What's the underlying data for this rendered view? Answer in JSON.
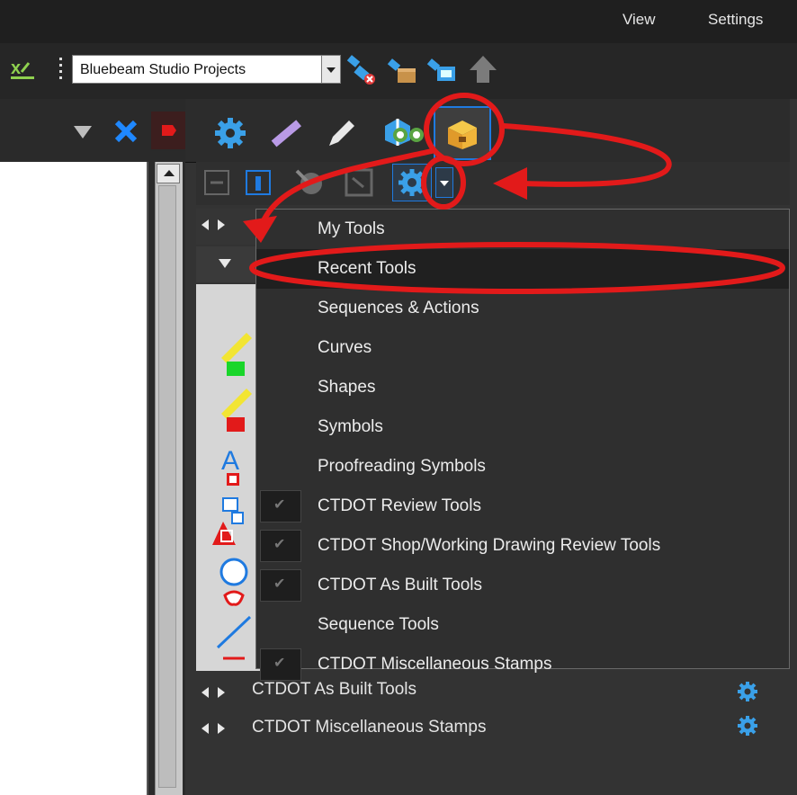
{
  "menubar": {
    "items": [
      "View",
      "Settings"
    ]
  },
  "toolbar": {
    "project_select_value": "Bluebeam Studio Projects"
  },
  "dropdown": {
    "items": [
      {
        "label": "My Tools",
        "checked": false
      },
      {
        "label": "Recent Tools",
        "checked": false
      },
      {
        "label": "Sequences & Actions",
        "checked": false
      },
      {
        "label": "Curves",
        "checked": false
      },
      {
        "label": "Shapes",
        "checked": false
      },
      {
        "label": "Symbols",
        "checked": false
      },
      {
        "label": "Proofreading Symbols",
        "checked": false
      },
      {
        "label": "CTDOT Review Tools",
        "checked": true
      },
      {
        "label": "CTDOT Shop/Working Drawing Review Tools",
        "checked": true
      },
      {
        "label": "CTDOT As Built Tools",
        "checked": true
      },
      {
        "label": "Sequence Tools",
        "checked": false
      },
      {
        "label": "CTDOT Miscellaneous Stamps",
        "checked": true
      }
    ]
  },
  "sections": {
    "as_built": "CTDOT As Built Tools",
    "misc_stamps": "CTDOT Miscellaneous Stamps"
  },
  "colors": {
    "annotation_red": "#e21a1a",
    "accent_blue": "#1f7ae0"
  }
}
